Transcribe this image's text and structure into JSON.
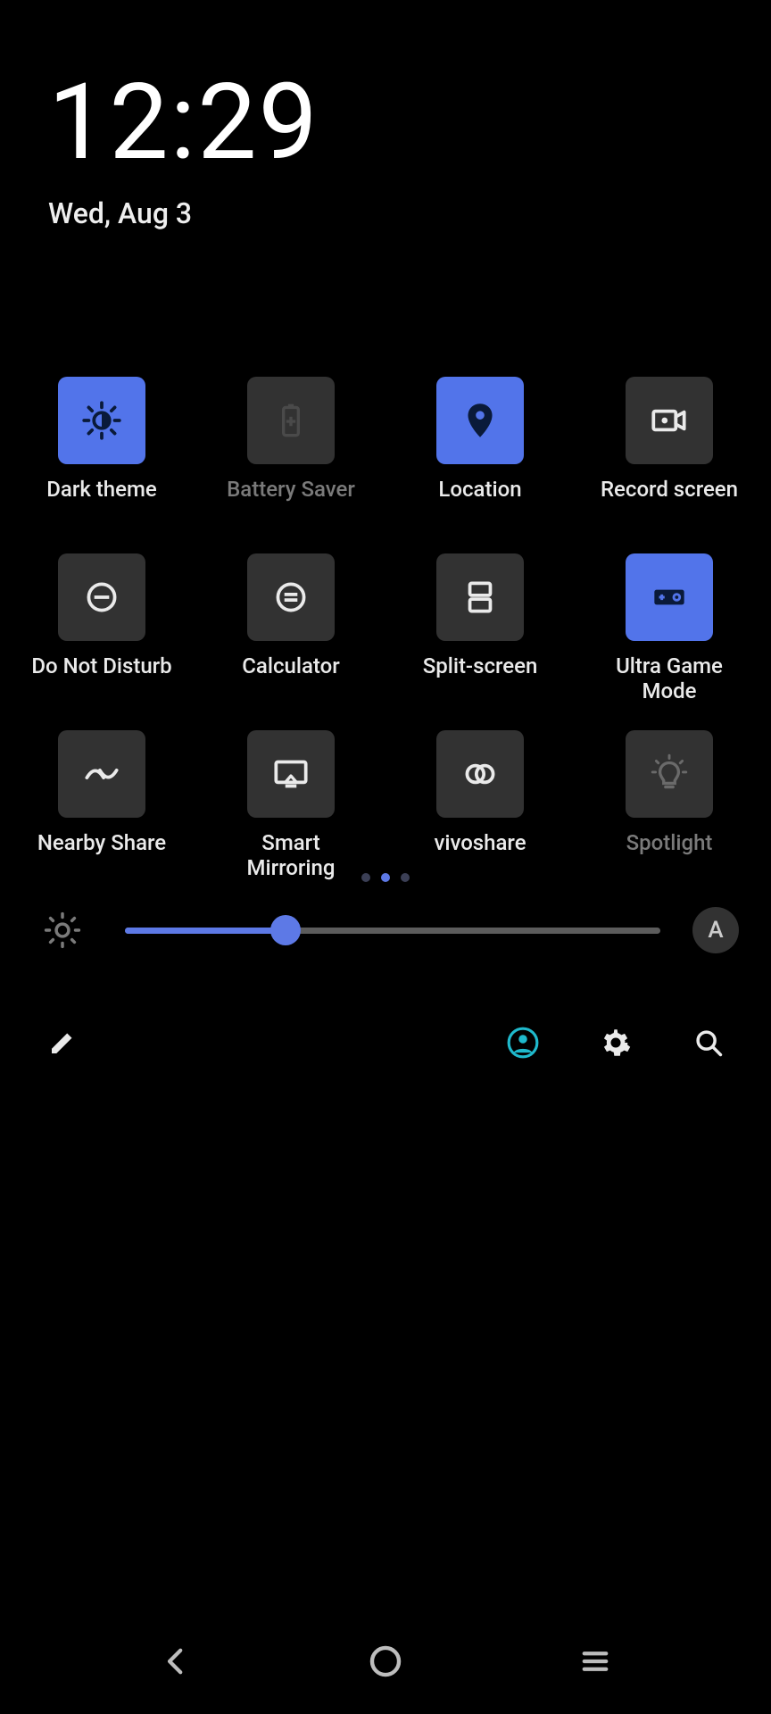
{
  "header": {
    "time": "12:29",
    "date": "Wed, Aug 3"
  },
  "tiles": [
    {
      "label": "Dark theme",
      "active": true,
      "dim": false
    },
    {
      "label": "Battery Saver",
      "active": false,
      "dim": true
    },
    {
      "label": "Location",
      "active": true,
      "dim": false
    },
    {
      "label": "Record screen",
      "active": false,
      "dim": false
    },
    {
      "label": "Do Not Disturb",
      "active": false,
      "dim": false
    },
    {
      "label": "Calculator",
      "active": false,
      "dim": false
    },
    {
      "label": "Split-screen",
      "active": false,
      "dim": false
    },
    {
      "label": "Ultra Game\nMode",
      "active": true,
      "dim": false
    },
    {
      "label": "Nearby Share",
      "active": false,
      "dim": false
    },
    {
      "label": "Smart\nMirroring",
      "active": false,
      "dim": false
    },
    {
      "label": "vivoshare",
      "active": false,
      "dim": false
    },
    {
      "label": "Spotlight",
      "active": false,
      "dim": true
    }
  ],
  "pager": {
    "count": 3,
    "active": 1
  },
  "brightness": {
    "percent": 30,
    "auto_label": "A"
  },
  "colors": {
    "accent": "#5274ea",
    "tile_off": "#323232",
    "user_ring": "#1fb9cc"
  }
}
